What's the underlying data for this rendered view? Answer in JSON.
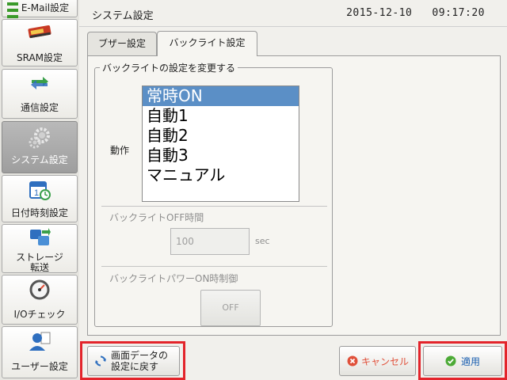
{
  "header": {
    "title": "システム設定",
    "date": "2015-12-10",
    "time": "09:17:20"
  },
  "sidebar": {
    "items": [
      {
        "label": "E-Mail設定",
        "icon": "download-arrow-icon",
        "active": false
      },
      {
        "label": "SRAM設定",
        "icon": "ram-chip-icon",
        "active": false
      },
      {
        "label": "通信設定",
        "icon": "exchange-arrows-icon",
        "active": false
      },
      {
        "label": "システム設定",
        "icon": "gears-icon",
        "active": true
      },
      {
        "label": "日付時刻設定",
        "icon": "calendar-clock-icon",
        "active": false
      },
      {
        "label_line1": "ストレージ",
        "label_line2": "転送",
        "icon": "storage-transfer-icon",
        "active": false
      },
      {
        "label": "I/Oチェック",
        "icon": "gauge-icon",
        "active": false
      },
      {
        "label": "ユーザー設定",
        "icon": "user-icon",
        "active": false
      }
    ]
  },
  "tabs": [
    {
      "label": "ブザー設定",
      "active": false
    },
    {
      "label": "バックライト設定",
      "active": true
    }
  ],
  "group": {
    "title": "バックライトの設定を変更する",
    "action_label": "動作",
    "options": [
      "常時ON",
      "自動1",
      "自動2",
      "自動3",
      "マニュアル"
    ],
    "selected": "常時ON",
    "off_time_label": "バックライトOFF時間",
    "off_time_value": "100",
    "off_time_unit": "sec",
    "power_on_label": "バックライトパワーON時制御",
    "power_on_value": "OFF"
  },
  "buttons": {
    "reset_line1": "画面データの",
    "reset_line2": "設定に戻す",
    "cancel": "キャンセル",
    "apply": "適用"
  },
  "colors": {
    "selection": "#5b8fc6",
    "highlight_frame": "#e3242b",
    "cancel_icon": "#e0503a",
    "apply_icon": "#4caa36"
  }
}
